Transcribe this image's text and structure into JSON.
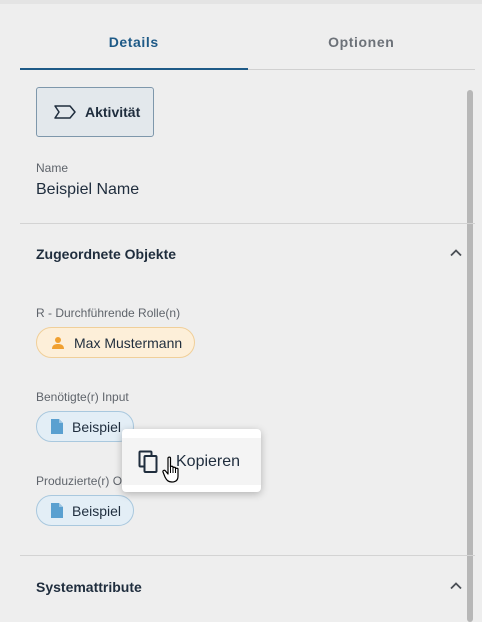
{
  "tabs": [
    {
      "label": "Details"
    },
    {
      "label": "Optionen"
    }
  ],
  "type_button": {
    "label": "Aktivität",
    "icon": "activity-tag-icon"
  },
  "name_field": {
    "label": "Name",
    "value": "Beispiel Name"
  },
  "sections": {
    "assigned": {
      "title": "Zugeordnete Objekte",
      "icon": "chevron-up-icon"
    },
    "system": {
      "title": "Systemattribute",
      "icon": "chevron-up-icon"
    }
  },
  "roles": {
    "label": "R - Durchführende Rolle(n)",
    "chip": {
      "label": "Max Mustermann",
      "icon": "person-icon"
    }
  },
  "inputs": {
    "label": "Benötigte(r) Input",
    "chip": {
      "label": "Beispiel",
      "icon": "document-icon"
    }
  },
  "outputs": {
    "label": "Produzierte(r) Output",
    "chip": {
      "label": "Beispiel",
      "icon": "document-icon"
    }
  },
  "context_menu": {
    "item": {
      "label": "Kopieren",
      "icon": "copy-icon"
    }
  },
  "colors": {
    "accent": "#1e5a87",
    "role_chip_bg": "#fdefd9",
    "doc_chip_bg": "#e3eef6",
    "person_icon": "#f0a030",
    "doc_icon": "#5aa0d0"
  }
}
